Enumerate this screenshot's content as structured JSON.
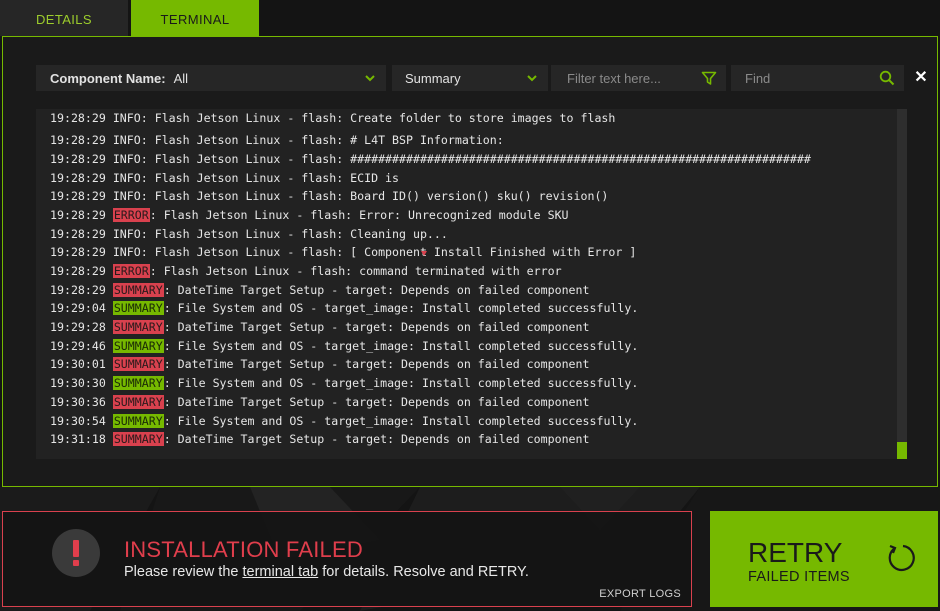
{
  "tabs": [
    {
      "label": "DETAILS"
    },
    {
      "label": "TERMINAL"
    }
  ],
  "toolbar": {
    "component_label": "Component Name:",
    "component_value": "All",
    "summary_value": "Summary",
    "filter_placeholder": "Filter text here...",
    "find_placeholder": "Find",
    "close_glyph": "✕"
  },
  "log": {
    "lines": [
      {
        "time": "19:28:29",
        "level": "INFO",
        "rest": ": Flash Jetson Linux - flash: Create folder to store images to flash"
      },
      {
        "time": "19:28:29",
        "level": "INFO",
        "rest": ": Flash Jetson Linux - flash: # L4T BSP Information:"
      },
      {
        "time": "19:28:29",
        "level": "INFO",
        "rest": ": Flash Jetson Linux - flash: ##################################################################"
      },
      {
        "time": "19:28:29",
        "level": "INFO",
        "rest": ": Flash Jetson Linux - flash: ECID is"
      },
      {
        "time": "19:28:29",
        "level": "INFO",
        "rest": ": Flash Jetson Linux - flash: Board ID() version() sku() revision()"
      },
      {
        "time": "19:28:29",
        "level": "ERROR",
        "rest": ": Flash Jetson Linux - flash: Error: Unrecognized module SKU"
      },
      {
        "time": "19:28:29",
        "level": "INFO",
        "rest": ": Flash Jetson Linux - flash: Cleaning up..."
      },
      {
        "time": "19:28:29",
        "level": "INFO",
        "rest": ": Flash Jetson Linux - flash: [ Component Install Finished with Error ]"
      },
      {
        "time": "19:28:29",
        "level": "ERROR",
        "rest": ": Flash Jetson Linux - flash: command terminated with error"
      },
      {
        "time": "19:28:29",
        "level": "SUMMARY",
        "status": "fail",
        "rest": ": DateTime Target Setup - target: Depends on failed component"
      },
      {
        "time": "19:29:04",
        "level": "SUMMARY",
        "status": "success",
        "rest": ": File System and OS - target_image: Install completed successfully."
      },
      {
        "time": "19:29:28",
        "level": "SUMMARY",
        "status": "fail",
        "rest": ": DateTime Target Setup - target: Depends on failed component"
      },
      {
        "time": "19:29:46",
        "level": "SUMMARY",
        "status": "success",
        "rest": ": File System and OS - target_image: Install completed successfully."
      },
      {
        "time": "19:30:01",
        "level": "SUMMARY",
        "status": "fail",
        "rest": ": DateTime Target Setup - target: Depends on failed component"
      },
      {
        "time": "19:30:30",
        "level": "SUMMARY",
        "status": "success",
        "rest": ": File System and OS - target_image: Install completed successfully."
      },
      {
        "time": "19:30:36",
        "level": "SUMMARY",
        "status": "fail",
        "rest": ": DateTime Target Setup - target: Depends on failed component"
      },
      {
        "time": "19:30:54",
        "level": "SUMMARY",
        "status": "success",
        "rest": ": File System and OS - target_image: Install completed successfully."
      },
      {
        "time": "19:31:18",
        "level": "SUMMARY",
        "status": "fail",
        "rest": ": DateTime Target Setup - target: Depends on failed component"
      }
    ]
  },
  "status": {
    "title": "INSTALLATION FAILED",
    "msg_before": "Please review the ",
    "msg_link": "terminal tab",
    "msg_after": " for details. Resolve and RETRY.",
    "export_label": "EXPORT LOGS"
  },
  "retry": {
    "title": "RETRY",
    "subtitle": "FAILED ITEMS"
  },
  "colors": {
    "accent": "#76b900",
    "error": "#d9414e",
    "background": "#141414"
  },
  "icons": {
    "chevron": "chevron-down-icon",
    "filter": "filter-icon",
    "search": "search-icon",
    "close": "close-icon",
    "alert": "alert-icon",
    "retry": "retry-icon"
  }
}
